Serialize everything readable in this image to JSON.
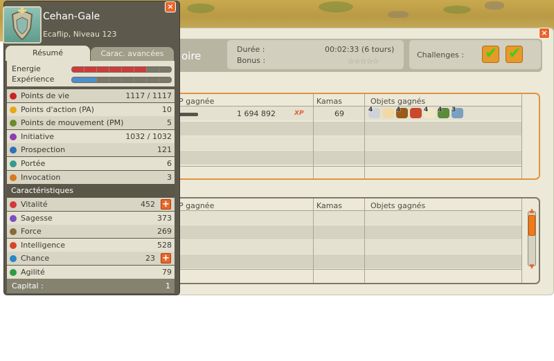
{
  "character": {
    "name": "Cehan-Gale",
    "subtitle": "Ecaflip, Niveau 123",
    "tabs": [
      "Résumé",
      "Carac. avancées"
    ],
    "energie_label": "Energie",
    "experience_label": "Expérience",
    "energie_level": 0.85,
    "experience_level": 0.35,
    "stats": [
      {
        "label": "Points de vie",
        "value": "1117 / 1117",
        "icon": "heart-icon",
        "color": "#cc2222"
      },
      {
        "label": "Points d'action (PA)",
        "value": "10",
        "icon": "star-icon",
        "color": "#e6a817"
      },
      {
        "label": "Points de mouvement (PM)",
        "value": "5",
        "icon": "boot-icon",
        "color": "#6b8a2a"
      },
      {
        "label": "Initiative",
        "value": "1032 / 1032",
        "icon": "initiative-icon",
        "color": "#8c3fb0"
      },
      {
        "label": "Prospection",
        "value": "121",
        "icon": "prospection-icon",
        "color": "#2f6fb8"
      },
      {
        "label": "Portée",
        "value": "6",
        "icon": "eye-icon",
        "color": "#3a9a8a"
      },
      {
        "label": "Invocation",
        "value": "3",
        "icon": "invocation-icon",
        "color": "#d9781e"
      }
    ],
    "carac_header": "Caractéristiques",
    "caracs": [
      {
        "label": "Vitalité",
        "value": "452",
        "plus": true,
        "icon": "vitality-icon",
        "color": "#d23a3a"
      },
      {
        "label": "Sagesse",
        "value": "373",
        "plus": false,
        "icon": "wisdom-icon",
        "color": "#7b4fc0"
      },
      {
        "label": "Force",
        "value": "269",
        "plus": false,
        "icon": "strength-icon",
        "color": "#8a6a3a"
      },
      {
        "label": "Intelligence",
        "value": "528",
        "plus": false,
        "icon": "intelligence-icon",
        "color": "#d6452a"
      },
      {
        "label": "Chance",
        "value": "23",
        "plus": true,
        "icon": "chance-icon",
        "color": "#2a86c8"
      },
      {
        "label": "Agilité",
        "value": "79",
        "plus": false,
        "icon": "agility-icon",
        "color": "#2f9a4a"
      }
    ],
    "capital_label": "Capital :",
    "capital_value": "1",
    "close_label": "×"
  },
  "fight": {
    "title_fragment": "oire",
    "duree_label": "Durée :",
    "duree_value": "00:02:33 (6 tours)",
    "bonus_label": "Bonus :",
    "bonus_stars": "☆☆☆☆☆",
    "challenges_label": "Challenges :",
    "close_label": "×",
    "columns": [
      "P gagnée",
      "Kamas",
      "Objets gagnés"
    ],
    "winner": {
      "xp": "1 694 892",
      "xp_tag": "XP",
      "kamas": "69",
      "items": [
        {
          "q": "4",
          "color": "#cfd3d8"
        },
        {
          "q": "",
          "color": "#f0d9a6"
        },
        {
          "q": "4",
          "color": "#9a5a1a"
        },
        {
          "q": "",
          "color": "#c94a2a"
        },
        {
          "q": "4",
          "color": "#f1e7c4"
        },
        {
          "q": "4",
          "color": "#5a8a3a"
        },
        {
          "q": "3",
          "color": "#7aa0c0"
        }
      ]
    }
  }
}
